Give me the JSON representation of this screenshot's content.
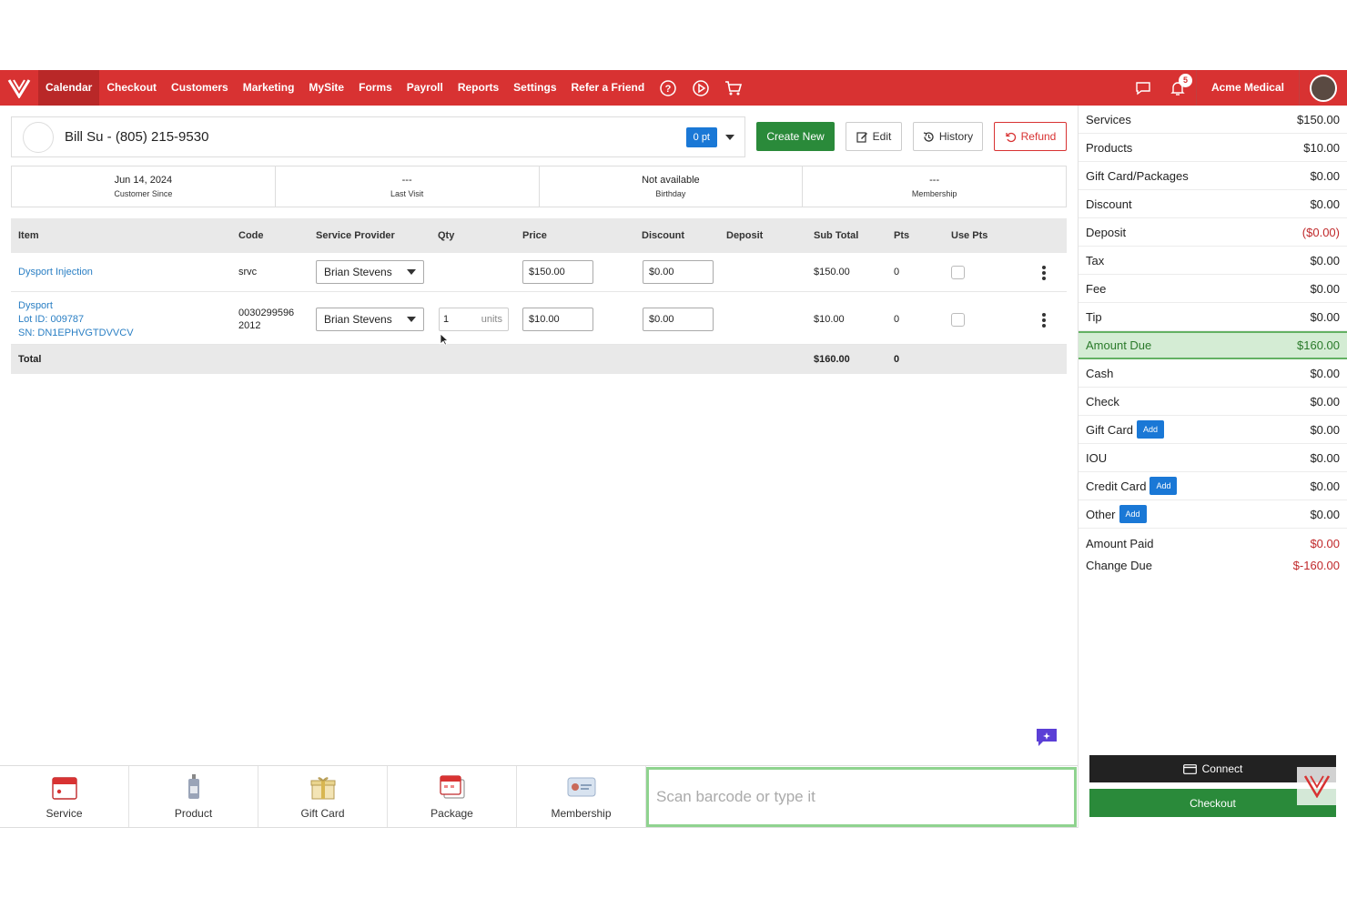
{
  "nav": {
    "items": [
      "Calendar",
      "Checkout",
      "Customers",
      "Marketing",
      "MySite",
      "Forms",
      "Payroll",
      "Reports",
      "Settings",
      "Refer a Friend"
    ],
    "active": "Calendar",
    "notification_count": "5",
    "account_name": "Acme Medical",
    "brand_color": "#d83232"
  },
  "customer": {
    "name": "Bill Su - (805) 215-9530",
    "points_button": "0 pt",
    "create_new": "Create New",
    "edit": "Edit",
    "history": "History",
    "refund": "Refund"
  },
  "info": [
    {
      "value": "Jun 14, 2024",
      "label": "Customer Since"
    },
    {
      "value": "---",
      "label": "Last Visit"
    },
    {
      "value": "Not available",
      "label": "Birthday"
    },
    {
      "value": "---",
      "label": "Membership"
    }
  ],
  "table": {
    "headers": {
      "item": "Item",
      "code": "Code",
      "provider": "Service Provider",
      "qty": "Qty",
      "price": "Price",
      "discount": "Discount",
      "deposit": "Deposit",
      "subtotal": "Sub Total",
      "pts": "Pts",
      "use_pts": "Use Pts"
    },
    "rows": [
      {
        "item": "Dysport Injection",
        "code": "srvc",
        "provider": "Brian Stevens",
        "qty": "",
        "price": "$150.00",
        "discount": "$0.00",
        "subtotal": "$150.00",
        "pts": "0"
      },
      {
        "item": "Dysport",
        "lot": "Lot ID: 009787",
        "sn": "SN: DN1EPHVGTDVVCV",
        "code_line1": "0030299596",
        "code_line2": "2012",
        "provider": "Brian Stevens",
        "qty": "1",
        "qty_unit": "units",
        "price": "$10.00",
        "discount": "$0.00",
        "subtotal": "$10.00",
        "pts": "0"
      }
    ],
    "total": {
      "label": "Total",
      "subtotal": "$160.00",
      "pts": "0"
    }
  },
  "summary": {
    "services": {
      "label": "Services",
      "value": "$150.00"
    },
    "products": {
      "label": "Products",
      "value": "$10.00"
    },
    "gift": {
      "label": "Gift Card/Packages",
      "value": "$0.00"
    },
    "discount": {
      "label": "Discount",
      "value": "$0.00"
    },
    "deposit": {
      "label": "Deposit",
      "value": "($0.00)"
    },
    "tax": {
      "label": "Tax",
      "value": "$0.00"
    },
    "fee": {
      "label": "Fee",
      "value": "$0.00"
    },
    "tip": {
      "label": "Tip",
      "value": "$0.00"
    },
    "amount_due": {
      "label": "Amount Due",
      "value": "$160.00"
    },
    "cash": {
      "label": "Cash",
      "value": "$0.00"
    },
    "check": {
      "label": "Check",
      "value": "$0.00"
    },
    "gift_card": {
      "label": "Gift Card",
      "value": "$0.00"
    },
    "iou": {
      "label": "IOU",
      "value": "$0.00"
    },
    "credit_card": {
      "label": "Credit Card",
      "value": "$0.00"
    },
    "other": {
      "label": "Other",
      "value": "$0.00"
    },
    "amount_paid": {
      "label": "Amount Paid",
      "value": "$0.00"
    },
    "change_due": {
      "label": "Change Due",
      "value": "$-160.00"
    },
    "add_label": "Add"
  },
  "actions": {
    "connect": "Connect",
    "checkout": "Checkout"
  },
  "bottom": {
    "tiles": [
      "Service",
      "Product",
      "Gift Card",
      "Package",
      "Membership"
    ],
    "scan_placeholder": "Scan barcode or type it"
  }
}
